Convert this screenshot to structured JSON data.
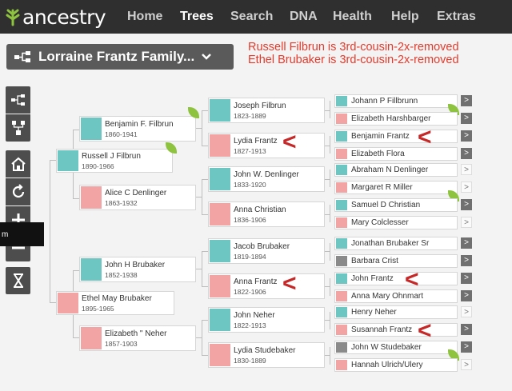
{
  "brand": {
    "name": "ancestry"
  },
  "nav": {
    "items": [
      "Home",
      "Trees",
      "Search",
      "DNA",
      "Health",
      "Help",
      "Extras"
    ],
    "active": "Trees"
  },
  "tree_title": "Lorraine Frantz Family...",
  "annotations": [
    "Russell Filbrun is 3rd-cousin-2x-removed",
    "Ethel Brubaker is 3rd-cousin-2x-removed"
  ],
  "tooltip": "m",
  "tools": [
    "pedigree-view-icon",
    "family-view-icon",
    "home-icon",
    "refresh-icon",
    "zoom-in-icon",
    "zoom-out-icon",
    "hourglass-icon"
  ],
  "people": {
    "russell": {
      "name": "Russell J Filbrun",
      "dates": "1890-1966"
    },
    "ethel": {
      "name": "Ethel May Brubaker",
      "dates": "1895-1965"
    },
    "benjamin": {
      "name": "Benjamin F. Filbrun",
      "dates": "1860-1941"
    },
    "alice": {
      "name": "Alice C Denlinger",
      "dates": "1863-1932"
    },
    "johnb": {
      "name": "John H Brubaker",
      "dates": "1852-1938"
    },
    "elizabeth": {
      "name": "Elizabeth \" Neher",
      "dates": "1857-1903"
    },
    "joseph": {
      "name": "Joseph Filbrun",
      "dates": "1823-1889"
    },
    "lydia": {
      "name": "Lydia Frantz",
      "dates": "1827-1913"
    },
    "johnd": {
      "name": "John W. Denlinger",
      "dates": "1833-1920"
    },
    "anna": {
      "name": "Anna Christian",
      "dates": "1836-1906"
    },
    "jacob": {
      "name": "Jacob Brubaker",
      "dates": "1819-1894"
    },
    "annaf": {
      "name": "Anna Frantz",
      "dates": "1822-1906"
    },
    "johnn": {
      "name": "John Neher",
      "dates": "1822-1913"
    },
    "lydias": {
      "name": "Lydia Studebaker",
      "dates": "1830-1889"
    },
    "g1": {
      "name": "Johann P Fillbrunn"
    },
    "g2": {
      "name": "Elizabeth Harshbarger"
    },
    "g3": {
      "name": "Benjamin Frantz"
    },
    "g4": {
      "name": "Elizabeth Flora"
    },
    "g5": {
      "name": "Abraham N Denlinger"
    },
    "g6": {
      "name": "Margaret R Miller"
    },
    "g7": {
      "name": "Samuel D Christian"
    },
    "g8": {
      "name": "Mary Colclesser"
    },
    "g9": {
      "name": "Jonathan Brubaker Sr"
    },
    "g10": {
      "name": "Barbara Crist"
    },
    "g11": {
      "name": "John Frantz"
    },
    "g12": {
      "name": "Anna Mary Ohnmart"
    },
    "g13": {
      "name": "Henry Neher"
    },
    "g14": {
      "name": "Susannah Frantz"
    },
    "g15": {
      "name": "John W Studebaker"
    },
    "g16": {
      "name": "Hannah Ulrich/Ulery"
    }
  },
  "more_label": ">",
  "marker_label": "<"
}
